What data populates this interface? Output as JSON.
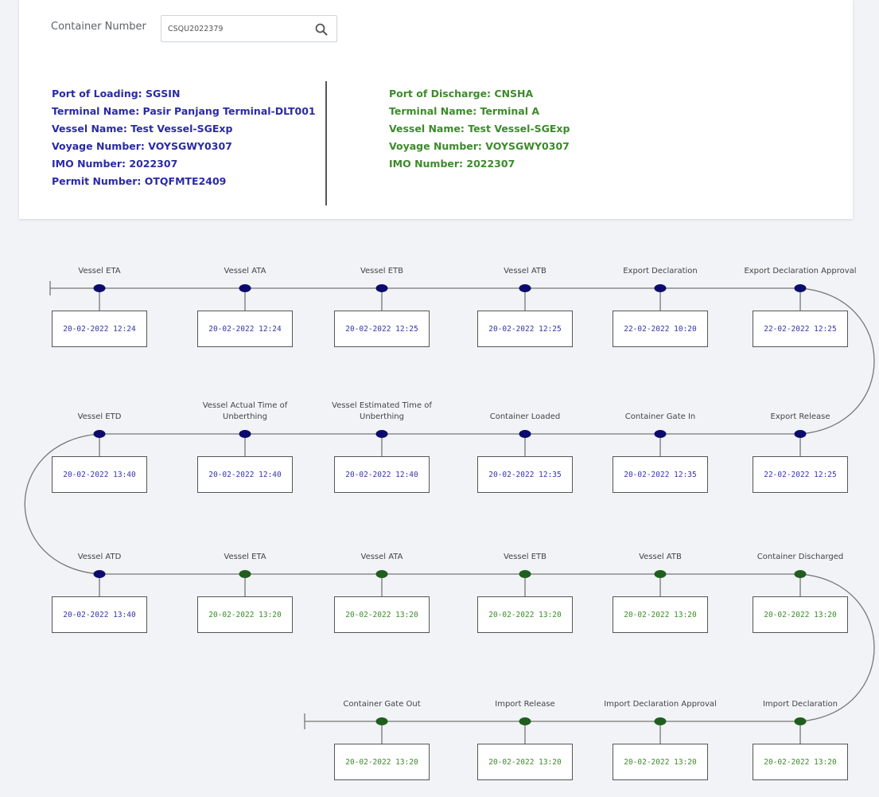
{
  "search": {
    "label": "Container Number",
    "value": "CSQU2022379",
    "icon": "search-icon"
  },
  "loading": {
    "port": "Port of Loading: SGSIN",
    "terminal": "Terminal Name: Pasir Panjang Terminal-DLT001",
    "vessel": "Vessel Name: Test Vessel-SGExp",
    "voyage": "Voyage Number: VOYSGWY0307",
    "imo": "IMO Number: 2022307",
    "permit": "Permit Number: OTQFMTE2409"
  },
  "discharge": {
    "port": "Port of Discharge: CNSHA",
    "terminal": "Terminal Name: Terminal A",
    "vessel": "Vessel Name: Test Vessel-SGExp",
    "voyage": "Voyage Number: VOYSGWY0307",
    "imo": "IMO Number: 2022307"
  },
  "colors": {
    "blue": "#0b0b6e",
    "green": "#1f5e1f",
    "line": "#777777"
  },
  "timeline": {
    "rows": [
      [
        {
          "label": "Vessel ETA",
          "date": "20-02-2022 12:24",
          "color": "blue"
        },
        {
          "label": "Vessel ATA",
          "date": "20-02-2022 12:24",
          "color": "blue"
        },
        {
          "label": "Vessel ETB",
          "date": "20-02-2022 12:25",
          "color": "blue"
        },
        {
          "label": "Vessel ATB",
          "date": "20-02-2022 12:25",
          "color": "blue"
        },
        {
          "label": "Export Declaration",
          "date": "22-02-2022 10:20",
          "color": "blue"
        },
        {
          "label": "Export Declaration Approval",
          "date": "22-02-2022 12:25",
          "color": "blue"
        }
      ],
      [
        {
          "label": "Vessel ETD",
          "date": "20-02-2022 13:40",
          "color": "blue"
        },
        {
          "label": "Vessel Actual Time of Unberthing",
          "date": "20-02-2022 12:40",
          "color": "blue"
        },
        {
          "label": "Vessel Estimated Time of Unberthing",
          "date": "20-02-2022 12:40",
          "color": "blue"
        },
        {
          "label": "Container Loaded",
          "date": "20-02-2022 12:35",
          "color": "blue"
        },
        {
          "label": "Container Gate In",
          "date": "20-02-2022 12:35",
          "color": "blue"
        },
        {
          "label": "Export Release",
          "date": "22-02-2022 12:25",
          "color": "blue"
        }
      ],
      [
        {
          "label": "Vessel ATD",
          "date": "20-02-2022 13:40",
          "color": "blue"
        },
        {
          "label": "Vessel ETA",
          "date": "20-02-2022 13:20",
          "color": "green"
        },
        {
          "label": "Vessel ATA",
          "date": "20-02-2022 13:20",
          "color": "green"
        },
        {
          "label": "Vessel ETB",
          "date": "20-02-2022 13:20",
          "color": "green"
        },
        {
          "label": "Vessel ATB",
          "date": "20-02-2022 13:20",
          "color": "green"
        },
        {
          "label": "Container Discharged",
          "date": "20-02-2022 13:20",
          "color": "green"
        }
      ],
      [
        {
          "label": "Container Gate Out",
          "date": "20-02-2022 13:20",
          "color": "green"
        },
        {
          "label": "Import Release",
          "date": "20-02-2022 13:20",
          "color": "green"
        },
        {
          "label": "Import Declaration Approval",
          "date": "20-02-2022 13:20",
          "color": "green"
        },
        {
          "label": "Import Declaration",
          "date": "20-02-2022 13:20",
          "color": "green"
        }
      ]
    ]
  }
}
